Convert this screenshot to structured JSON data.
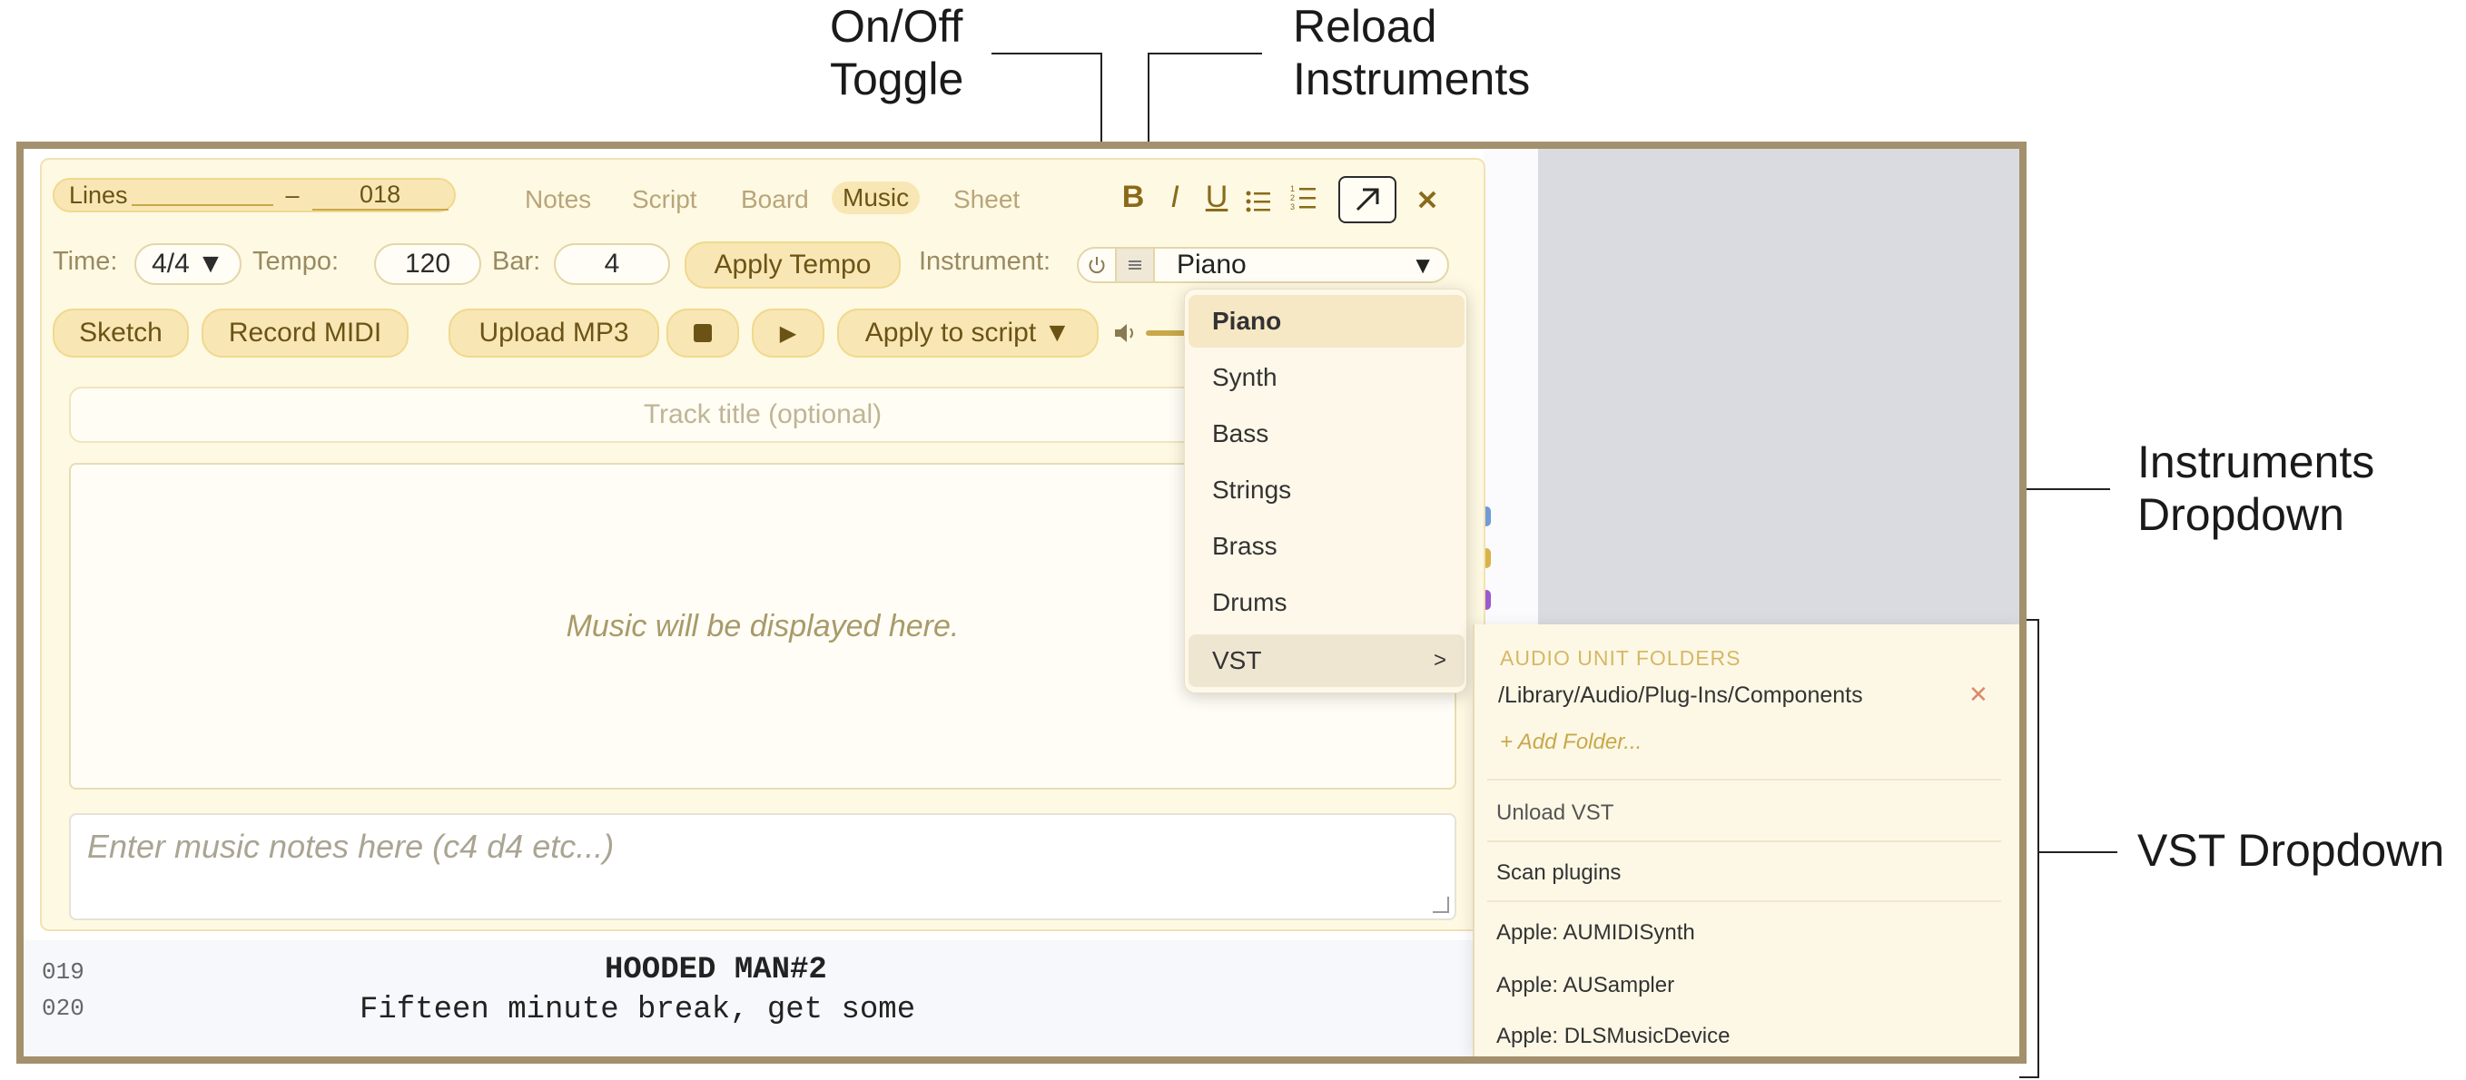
{
  "annotations": {
    "onoff_toggle": "On/Off\nToggle",
    "reload_instruments": "Reload\nInstruments",
    "instruments_dropdown": "Instruments\nDropdown",
    "vst_dropdown": "VST Dropdown"
  },
  "header": {
    "lines_label": "Lines",
    "lines_from": "",
    "lines_dash": "–",
    "lines_to": "018",
    "tabs": [
      "Notes",
      "Script",
      "Board",
      "Music",
      "Sheet"
    ],
    "active_tab": "Music",
    "format_buttons": [
      "B",
      "I",
      "U",
      "bullet-list",
      "numbered-list"
    ],
    "expand_icon": "arrow-up-right-icon",
    "close_icon": "close-icon"
  },
  "settings": {
    "time_label": "Time:",
    "time_value": "4/4 ▼",
    "tempo_label": "Tempo:",
    "tempo_value": "120",
    "bar_label": "Bar:",
    "bar_value": "4",
    "apply_tempo": "Apply Tempo",
    "instrument_label": "Instrument:",
    "power_icon": "⏻",
    "reload_icon": "≡",
    "instrument_value": "Piano",
    "instrument_arrow": "▼"
  },
  "actions": {
    "sketch": "Sketch",
    "record_midi": "Record MIDI",
    "upload_mp3": "Upload MP3",
    "stop_icon": "■",
    "play_icon": "▶",
    "apply_to_script": "Apply to script ▼",
    "volume_icon": "🔈"
  },
  "track_title_placeholder": "Track title (optional)",
  "music_placeholder": "Music will be displayed here.",
  "notes_placeholder": "Enter music notes here (c4 d4 etc...)",
  "script_lines": [
    {
      "num": "019",
      "text": "HOODED MAN#2"
    },
    {
      "num": "020",
      "text": "Fifteen minute break, get some"
    }
  ],
  "instrument_menu": {
    "items": [
      "Piano",
      "Synth",
      "Bass",
      "Strings",
      "Brass",
      "Drums",
      "VST"
    ],
    "selected": "Piano",
    "vst_arrow": ">"
  },
  "vst_menu": {
    "folders_header": "AUDIO UNIT FOLDERS",
    "folder_path": "/Library/Audio/Plug-Ins/Components",
    "remove_icon": "✕",
    "add_folder": "+ Add Folder...",
    "unload": "Unload VST",
    "scan": "Scan plugins",
    "plugins": [
      "Apple: AUMIDISynth",
      "Apple: AUSampler",
      "Apple: DLSMusicDevice"
    ]
  },
  "colors": {
    "accent": "#f8e7b4",
    "accent_border": "#f0d98e",
    "frame": "#a3906c",
    "panel": "#fef9e3"
  }
}
